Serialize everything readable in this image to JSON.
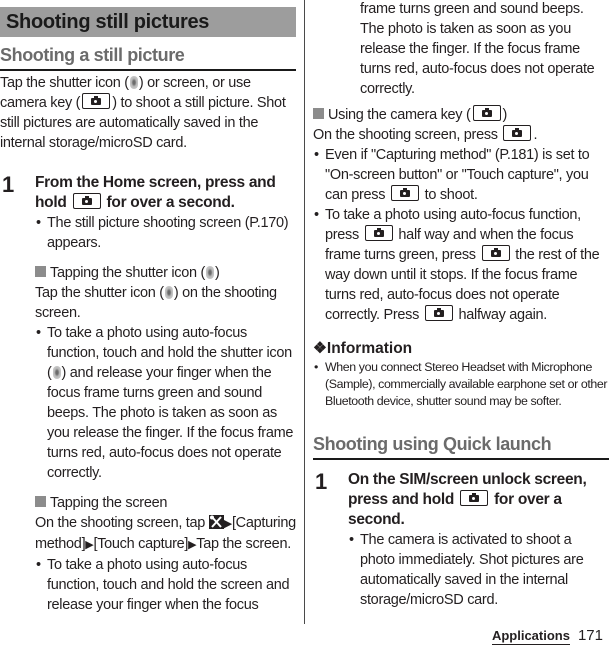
{
  "page": {
    "section_title": "Shooting still pictures",
    "footer_section": "Applications",
    "page_number": "171"
  },
  "left": {
    "subhead": "Shooting a still picture",
    "intro": {
      "part1": "Tap the shutter icon (",
      "part2": ") or screen, or use camera key (",
      "part3": ") to shoot a still picture. Shot still pictures are automatically saved in the internal storage/microSD card."
    },
    "step1": {
      "number": "1",
      "title_part1": "From the Home screen, press and hold ",
      "title_part2": " for over a second.",
      "bullet": "The still picture shooting screen (P.170) appears."
    },
    "shutter_block": {
      "title_part1": "Tapping the shutter icon (",
      "title_part2": ")",
      "text_part1": "Tap the shutter icon (",
      "text_part2": ") on the shooting screen.",
      "bullet_part1": "To take a photo using auto-focus function, touch and hold the shutter icon (",
      "bullet_part2": ") and release your finger when the focus frame turns green and sound beeps. The photo is taken as soon as you release the finger. If the focus frame turns red, auto-focus does not operate correctly."
    },
    "screen_block": {
      "title": "Tapping the screen",
      "text_part1": "On the shooting screen, tap ",
      "menu1": "[Capturing method]",
      "menu2": "[Touch capture]",
      "menu3": "Tap the screen.",
      "bullet": "To take a photo using auto-focus function, touch and hold the screen and release your finger when the focus"
    }
  },
  "right": {
    "continued": "frame turns green and sound beeps. The photo is taken as soon as you release the finger. If the focus frame turns red, auto-focus does not operate correctly.",
    "camkey_block": {
      "title_part1": "Using the camera key (",
      "title_part2": ")",
      "text_part1": "On the shooting screen, press ",
      "text_part2": ".",
      "bullet1_part1": "Even if \"Capturing method\" (P.181) is set to \"On-screen button\" or \"Touch capture\", you can press ",
      "bullet1_part2": " to shoot.",
      "bullet2_part1": "To take a photo using auto-focus function, press ",
      "bullet2_part2": " half way and when the focus frame turns green, press ",
      "bullet2_part3": " the rest of the way down until it stops. If the focus frame turns red, auto-focus does not operate correctly. Press ",
      "bullet2_part4": " halfway again."
    },
    "information": {
      "title": "❖Information",
      "bullet": "When you connect Stereo Headset with Microphone (Sample), commercially available earphone set or other Bluetooth device, shutter sound may be softer."
    },
    "quick_launch": {
      "subhead": "Shooting using Quick launch",
      "step_number": "1",
      "title_part1": "On the SIM/screen unlock screen, press and hold ",
      "title_part2": " for over a second.",
      "bullet": "The camera is activated to shoot a photo immediately. Shot pictures are automatically saved in the internal storage/microSD card."
    }
  },
  "icons": {
    "camera_key": "camera-key-icon",
    "shutter": "shutter-icon",
    "tools": "tools-icon",
    "arrow": "▶",
    "bullet": "•"
  }
}
